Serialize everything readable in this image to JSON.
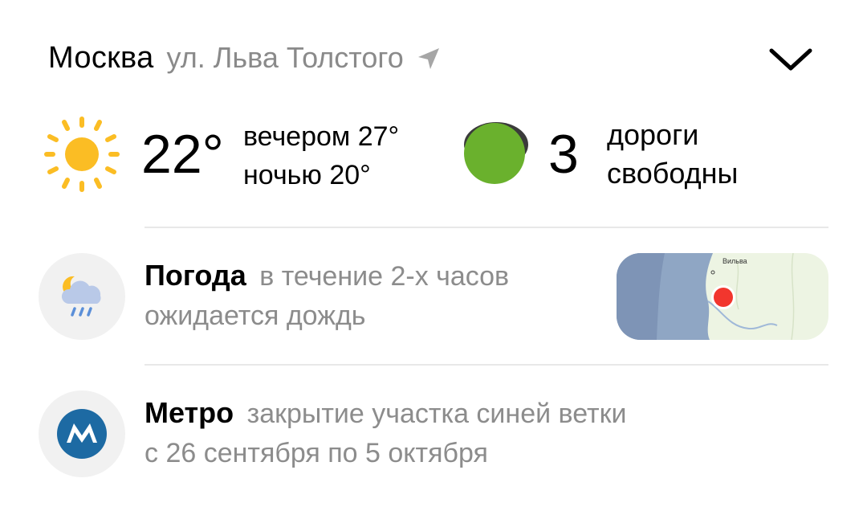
{
  "header": {
    "city": "Москва",
    "street": "ул. Льва Толстого",
    "location_icon": "location-arrow-icon",
    "expand_icon": "chevron-down-icon"
  },
  "weather": {
    "icon": "sun-icon",
    "current_temp": "22°",
    "evening": "вечером 27°",
    "night": "ночью 20°"
  },
  "traffic": {
    "icon": "traffic-light-icon",
    "score": "3",
    "line1": "дороги",
    "line2": "свободны",
    "color": "#6ab12d"
  },
  "alerts": [
    {
      "icon": "moon-cloud-rain-icon",
      "title": "Погода",
      "subtitle": "в течение 2-х часов",
      "detail": "ожидается дождь",
      "map_label": "Вильва"
    },
    {
      "icon": "metro-icon",
      "title": "Метро",
      "subtitle": "закрытие участка синей ветки",
      "detail": "с 26 сентября по 5 октября"
    }
  ],
  "colors": {
    "sun": "#fbbd24",
    "rain_map": "#8fa6c4",
    "metro_blue": "#1d6aa3",
    "alert_dot": "#f2362e",
    "muted_text": "#8c8c8c"
  }
}
